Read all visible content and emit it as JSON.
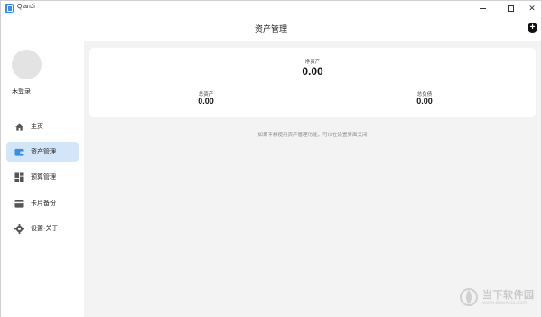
{
  "window": {
    "title": "QianJi",
    "controls": [
      "minimize",
      "maximize",
      "close"
    ]
  },
  "header": {
    "title": "资产管理",
    "add_icon": "plus-circle-icon"
  },
  "sidebar": {
    "user_label": "未登录",
    "items": [
      {
        "label": "主页",
        "icon": "home-icon",
        "active": false
      },
      {
        "label": "资产管理",
        "icon": "wallet-icon",
        "active": true
      },
      {
        "label": "预算管理",
        "icon": "dashboard-icon",
        "active": false
      },
      {
        "label": "卡片备份",
        "icon": "card-icon",
        "active": false
      },
      {
        "label": "设置·关于",
        "icon": "gear-icon",
        "active": false
      }
    ],
    "active_color": "#d3e5f8"
  },
  "summary": {
    "net_assets_label": "净资产",
    "net_assets_value": "0.00",
    "total_assets_label": "总资产",
    "total_assets_value": "0.00",
    "total_liabilities_label": "总负债",
    "total_liabilities_value": "0.00"
  },
  "hint": "如果不想使用资产管理功能，可以在设置界面关闭",
  "watermark": {
    "text": "当下软件园",
    "url": "www.downxia.com"
  },
  "colors": {
    "accent": "#3b8ee8",
    "main_bg": "#f3f3f3"
  }
}
